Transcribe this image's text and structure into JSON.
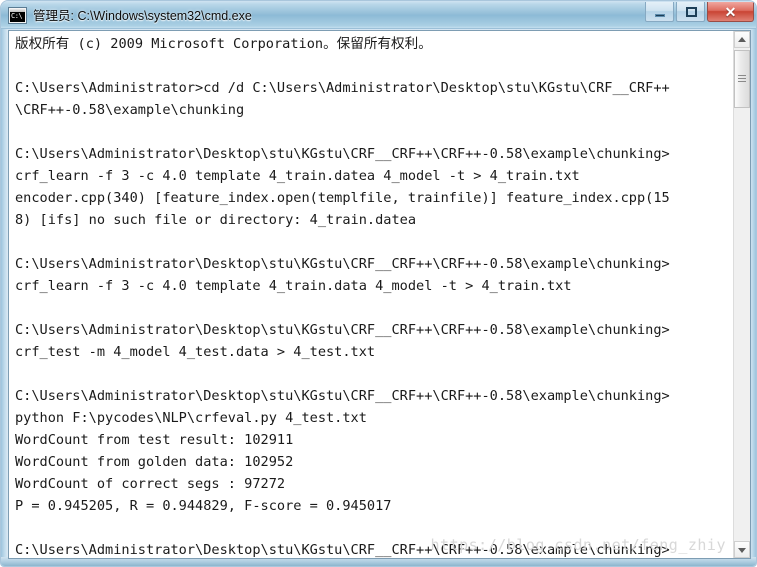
{
  "window": {
    "title": "管理员: C:\\Windows\\system32\\cmd.exe",
    "icon": "cmd-console-icon",
    "icon_text": "C:\\",
    "controls": {
      "minimize_label": "",
      "restore_label": "",
      "close_label": "✕"
    }
  },
  "console": {
    "lines": [
      "版权所有 (c) 2009 Microsoft Corporation。保留所有权利。",
      "",
      "C:\\Users\\Administrator>cd /d C:\\Users\\Administrator\\Desktop\\stu\\KGstu\\CRF__CRF++",
      "\\CRF++-0.58\\example\\chunking",
      "",
      "C:\\Users\\Administrator\\Desktop\\stu\\KGstu\\CRF__CRF++\\CRF++-0.58\\example\\chunking>",
      "crf_learn -f 3 -c 4.0 template 4_train.datea 4_model -t > 4_train.txt",
      "encoder.cpp(340) [feature_index.open(templfile, trainfile)] feature_index.cpp(15",
      "8) [ifs] no such file or directory: 4_train.datea",
      "",
      "C:\\Users\\Administrator\\Desktop\\stu\\KGstu\\CRF__CRF++\\CRF++-0.58\\example\\chunking>",
      "crf_learn -f 3 -c 4.0 template 4_train.data 4_model -t > 4_train.txt",
      "",
      "C:\\Users\\Administrator\\Desktop\\stu\\KGstu\\CRF__CRF++\\CRF++-0.58\\example\\chunking>",
      "crf_test -m 4_model 4_test.data > 4_test.txt",
      "",
      "C:\\Users\\Administrator\\Desktop\\stu\\KGstu\\CRF__CRF++\\CRF++-0.58\\example\\chunking>",
      "python F:\\pycodes\\NLP\\crfeval.py 4_test.txt",
      "WordCount from test result: 102911",
      "WordCount from golden data: 102952",
      "WordCount of correct segs : 97272",
      "P = 0.945205, R = 0.944829, F-score = 0.945017",
      "",
      "C:\\Users\\Administrator\\Desktop\\stu\\KGstu\\CRF__CRF++\\CRF++-0.58\\example\\chunking>"
    ]
  },
  "watermark": {
    "text": "https://blog.csdn.net/feng_zhiy"
  },
  "scrollbar": {
    "up_arrow": "scroll-up-arrow",
    "down_arrow": "scroll-down-arrow"
  }
}
